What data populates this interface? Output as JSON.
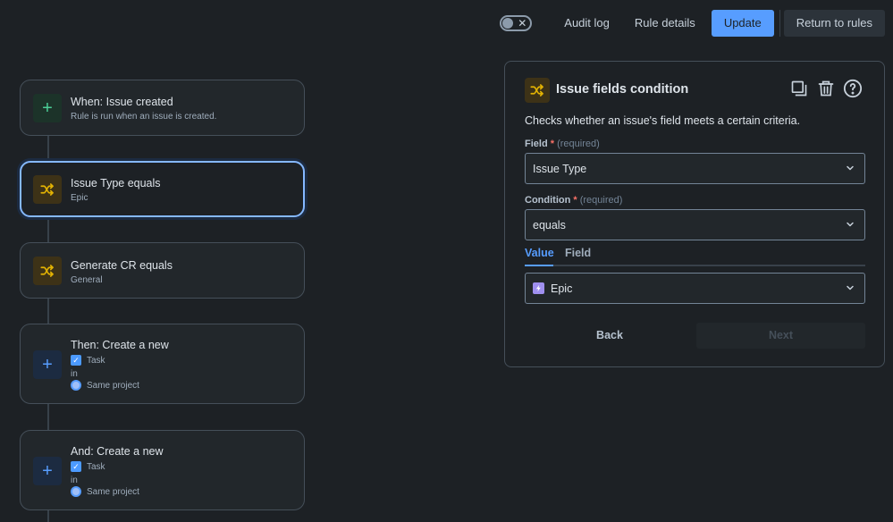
{
  "topbar": {
    "toggle_glyph": "✕",
    "audit_log": "Audit log",
    "rule_details": "Rule details",
    "update": "Update",
    "return_to_rules": "Return to rules"
  },
  "chain": {
    "trigger": {
      "title": "When: Issue created",
      "subtitle": "Rule is run when an issue is created.",
      "icon": "plus-icon"
    },
    "condition1": {
      "title": "Issue Type equals",
      "subtitle": "Epic",
      "icon": "shuffle-icon"
    },
    "condition2": {
      "title": "Generate CR equals",
      "subtitle": "General",
      "icon": "shuffle-icon"
    },
    "action1": {
      "title": "Then: Create a new",
      "type": "Task",
      "in": "in",
      "project": "Same project",
      "icon": "plus-icon"
    },
    "action2": {
      "title": "And: Create a new",
      "type": "Task",
      "in": "in",
      "project": "Same project",
      "icon": "plus-icon"
    }
  },
  "panel": {
    "title": "Issue fields condition",
    "description": "Checks whether an issue's field meets a certain criteria.",
    "field_label": "Field",
    "condition_label": "Condition",
    "required_star": "*",
    "required_text": "(required)",
    "field_value": "Issue Type",
    "condition_value": "equals",
    "tabs": {
      "value": "Value",
      "field": "Field"
    },
    "value_selected": "Epic",
    "back": "Back",
    "next": "Next"
  },
  "colors": {
    "background": "#1d2125",
    "accent": "#579dff",
    "condition_icon": "#e2b203",
    "trigger_icon": "#4bce97"
  }
}
